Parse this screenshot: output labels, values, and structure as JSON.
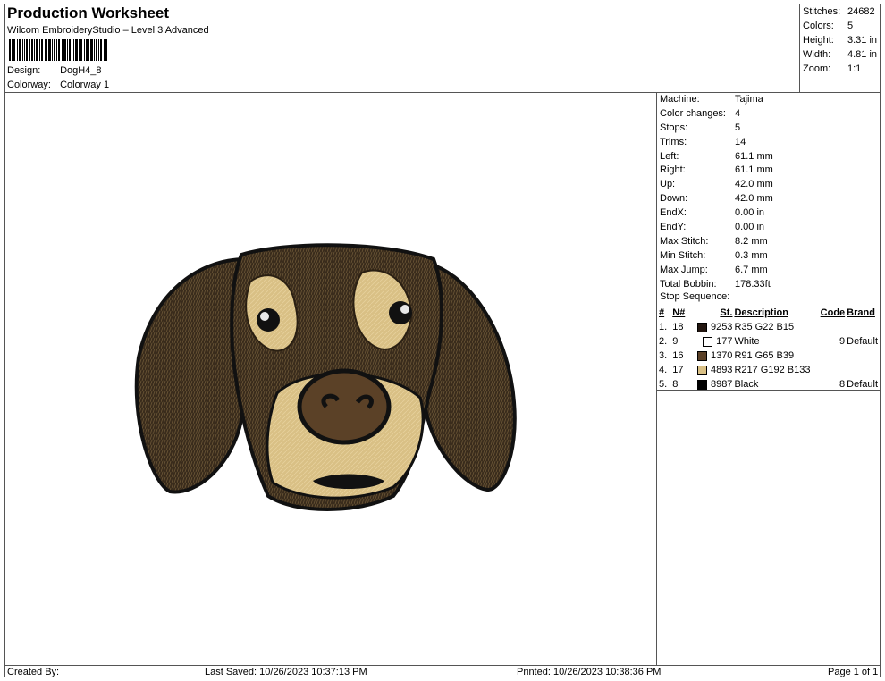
{
  "header": {
    "title": "Production Worksheet",
    "software": "Wilcom EmbroideryStudio – Level 3 Advanced",
    "design_label": "Design:",
    "design_value": "DogH4_8",
    "colorway_label": "Colorway:",
    "colorway_value": "Colorway 1"
  },
  "stats": [
    {
      "label": "Stitches:",
      "value": "24682"
    },
    {
      "label": "Colors:",
      "value": "5"
    },
    {
      "label": "Height:",
      "value": "3.31 in"
    },
    {
      "label": "Width:",
      "value": "4.81 in"
    },
    {
      "label": "Zoom:",
      "value": "1:1"
    }
  ],
  "specs": [
    {
      "label": "Machine:",
      "value": "Tajima"
    },
    {
      "label": "Color changes:",
      "value": "4"
    },
    {
      "label": "Stops:",
      "value": "5"
    },
    {
      "label": "Trims:",
      "value": "14"
    },
    {
      "label": "Left:",
      "value": "61.1 mm"
    },
    {
      "label": "Right:",
      "value": "61.1 mm"
    },
    {
      "label": "Up:",
      "value": "42.0 mm"
    },
    {
      "label": "Down:",
      "value": "42.0 mm"
    },
    {
      "label": "EndX:",
      "value": "0.00 in"
    },
    {
      "label": "EndY:",
      "value": "0.00 in"
    },
    {
      "label": "Max Stitch:",
      "value": "8.2 mm"
    },
    {
      "label": "Min Stitch:",
      "value": "0.3 mm"
    },
    {
      "label": "Max Jump:",
      "value": "6.7 mm"
    },
    {
      "label": "Total Bobbin:",
      "value": "178.33ft"
    }
  ],
  "stop_sequence": {
    "title": "Stop Sequence:",
    "headers": {
      "num": "#",
      "needle": "N#",
      "stitches": "St.",
      "description": "Description",
      "code": "Code",
      "brand": "Brand"
    },
    "rows": [
      {
        "num": "1.",
        "needle": "18",
        "color": "#231610",
        "stitches": "9253",
        "description": "R35 G22 B15",
        "code": "",
        "brand": ""
      },
      {
        "num": "2.",
        "needle": "9",
        "color": "#FFFFFF",
        "stitches": "177",
        "description": "White",
        "code": "9",
        "brand": "Default"
      },
      {
        "num": "3.",
        "needle": "16",
        "color": "#5B4127",
        "stitches": "1370",
        "description": "R91 G65 B39",
        "code": "",
        "brand": ""
      },
      {
        "num": "4.",
        "needle": "17",
        "color": "#D9C085",
        "stitches": "4893",
        "description": "R217 G192 B133",
        "code": "",
        "brand": ""
      },
      {
        "num": "5.",
        "needle": "8",
        "color": "#000000",
        "stitches": "8987",
        "description": "Black",
        "code": "8",
        "brand": "Default"
      }
    ]
  },
  "footer": {
    "created_by": "Created By:",
    "last_saved": "Last Saved: 10/26/2023 10:37:13 PM",
    "printed": "Printed: 10/26/2023 10:38:36 PM",
    "page": "Page 1 of 1"
  }
}
